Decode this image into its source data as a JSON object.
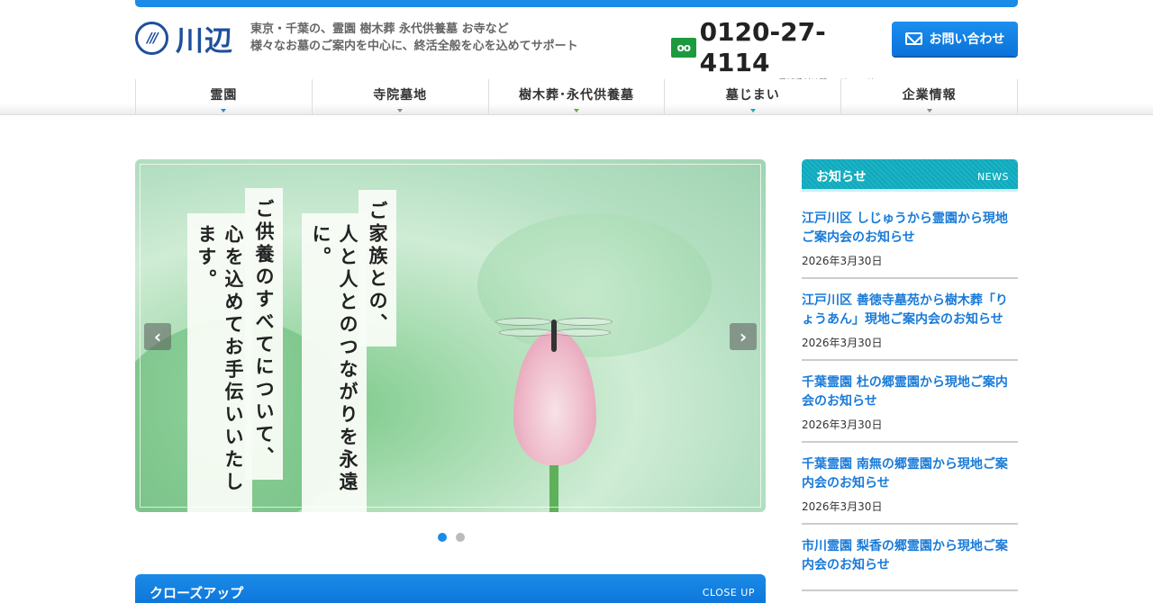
{
  "header": {
    "logo_mark": "///",
    "logo_text": "川辺",
    "tagline_line1": "東京・千葉の、霊園 樹木葬 永代供養墓 お寺など",
    "tagline_line2": "様々なお墓のご案内を中心に、終活全般を心を込めてサポート",
    "freedial_label": "oo",
    "phone_number": "0120-27-4114",
    "phone_hours": "(電話受付時間：9時〜17時)",
    "contact_label": "お問い合わせ"
  },
  "nav": {
    "items": [
      {
        "label": "霊園"
      },
      {
        "label": "寺院墓地"
      },
      {
        "label": "樹木葬･永代供養墓"
      },
      {
        "label": "墓じまい"
      },
      {
        "label": "企業情報"
      }
    ]
  },
  "slider": {
    "lines": [
      "ご家族との、",
      "人と人とのつながりを永遠に。",
      "ご供養のすべてについて、",
      "心を込めてお手伝いいたします。"
    ],
    "prev_label": "‹",
    "next_label": "›"
  },
  "closeup": {
    "title": "クローズアップ",
    "title_en": "CLOSE UP"
  },
  "news": {
    "title": "お知らせ",
    "title_en": "NEWS",
    "items": [
      {
        "title": "江戸川区 しじゅうから霊園から現地ご案内会のお知らせ",
        "date": "2026年3月30日"
      },
      {
        "title": "江戸川区 善徳寺墓苑から樹木葬「りょうあん」現地ご案内会のお知らせ",
        "date": "2026年3月30日"
      },
      {
        "title": "千葉霊園 杜の郷霊園から現地ご案内会のお知らせ",
        "date": "2026年3月30日"
      },
      {
        "title": "千葉霊園 南無の郷霊園から現地ご案内会のお知らせ",
        "date": "2026年3月30日"
      },
      {
        "title": "市川霊園 梨香の郷霊園から現地ご案内会のお知らせ",
        "date": ""
      }
    ]
  },
  "colors": {
    "primary": "#1a8be6",
    "logo": "#1e4f9c",
    "news_header": "#1bb4c6",
    "link": "#1a7bd8",
    "freedial": "#1d9a3e"
  }
}
